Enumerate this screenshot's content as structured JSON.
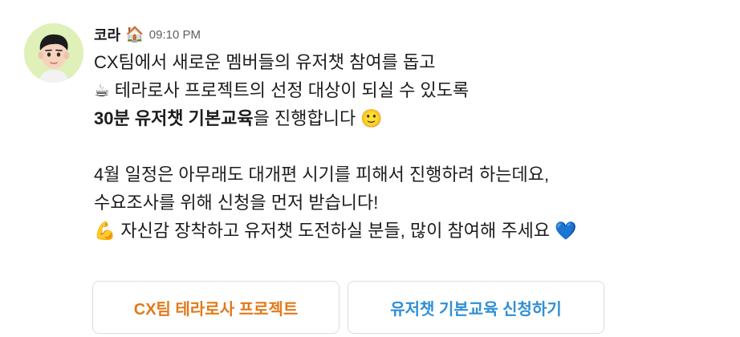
{
  "sender": {
    "name": "코라",
    "status_emoji": "🏠",
    "timestamp": "09:10 PM",
    "avatar_icon": "memoji-avatar"
  },
  "message": {
    "line1": "CX팀에서 새로운 멤버들의 유저챗 참여를 돕고",
    "line2_emoji": "☕",
    "line2": "테라로사 프로젝트의 선정 대상이 되실 수 있도록",
    "line3_bold": "30분 유저챗 기본교육",
    "line3_rest": "을 진행합니다",
    "line3_emoji": "🙂",
    "line4": "4월 일정은 아무래도 대개편 시기를 피해서 진행하려 하는데요,",
    "line5": "수요조사를 위해 신청을 먼저 받습니다!",
    "line6_emoji": "💪",
    "line6": "자신감 장착하고 유저챗 도전하실 분들, 많이 참여해 주세요",
    "line6_end_emoji": "💙"
  },
  "buttons": {
    "project_label": "CX팀 테라로사 프로젝트",
    "apply_label": "유저챗 기본교육 신청하기"
  },
  "colors": {
    "project_button_text": "#e27a1b",
    "apply_button_text": "#2f8fd6",
    "avatar_background": "#dff0b8"
  }
}
